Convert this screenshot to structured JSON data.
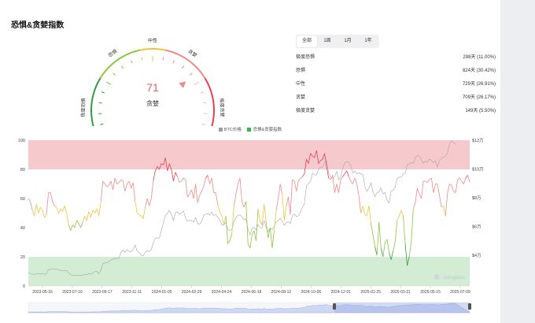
{
  "title": "恐惧&贪婪指数",
  "gauge": {
    "value": 71,
    "label": "贪婪",
    "zones": [
      "极度恐惧",
      "恐惧",
      "中性",
      "贪婪",
      "极度贪婪"
    ],
    "colors": [
      "#2e9e3e",
      "#8dc63f",
      "#f2c43d",
      "#f08a8a",
      "#e8404f"
    ]
  },
  "tabs": [
    {
      "label": "全部",
      "active": true
    },
    {
      "label": "1周",
      "active": false
    },
    {
      "label": "1月",
      "active": false
    },
    {
      "label": "1年",
      "active": false
    }
  ],
  "stats": [
    {
      "label": "极度恐惧",
      "value": "298天 (11.00%)"
    },
    {
      "label": "恐惧",
      "value": "824天 (30.42%)"
    },
    {
      "label": "中性",
      "value": "729天 (26.91%)"
    },
    {
      "label": "贪婪",
      "value": "709天 (26.17%)"
    },
    {
      "label": "极度贪婪",
      "value": "149天 (5.50%)"
    }
  ],
  "watermark": "coinglass",
  "chart_data": {
    "type": "line",
    "legend": [
      {
        "name": "BTC价格",
        "color": "#9e9e9e"
      },
      {
        "name": "恐惧&贪婪指数",
        "color": "#3cb44b"
      }
    ],
    "legend_position": "top-center",
    "x_ticks": [
      "2023-05-16",
      "2023-07-10",
      "2023-09-17",
      "2023-11-11",
      "2024-01-05",
      "2024-02-29",
      "2024-04-24",
      "2024-06-18",
      "2024-08-12",
      "2024-10-06",
      "2024-12-01",
      "2025-01-25",
      "2025-03-21",
      "2025-05-15",
      "2025-07-09"
    ],
    "y_left_ticks": [
      0,
      20,
      40,
      60,
      80,
      100
    ],
    "y_left_range": [
      0,
      100
    ],
    "y_right_ticks": [
      "$4万",
      "$6万",
      "$8万",
      "$10万",
      "$12万"
    ],
    "y_right_values": [
      40000,
      60000,
      80000,
      100000,
      120000
    ],
    "y_right_range": [
      18500,
      120000
    ],
    "bands": [
      {
        "from": 80,
        "to": 100,
        "color": "#f6c9cc"
      },
      {
        "from": 0,
        "to": 20,
        "color": "#d3ecd4"
      }
    ],
    "zone_colors": {
      "extreme_fear": "#2e9e3e",
      "fear": "#8dc63f",
      "neutral": "#f2c43d",
      "greed": "#f08a8a",
      "extreme_greed": "#e8404f"
    },
    "series": [
      {
        "name": "BTC价格",
        "values": [
          27500,
          27200,
          26800,
          26500,
          27000,
          27100,
          26900,
          27200,
          26500,
          27000,
          29800,
          30200,
          30500,
          30400,
          30200,
          29900,
          29300,
          29100,
          29300,
          29200,
          27800,
          26300,
          26100,
          25900,
          26000,
          26000,
          25800,
          26100,
          26600,
          26300,
          27200,
          26700,
          27600,
          28500,
          28700,
          27100,
          29400,
          34000,
          34500,
          34700,
          35400,
          36700,
          37100,
          37800,
          37600,
          37900,
          41800,
          43400,
          42000,
          43700,
          42500,
          42300,
          44200,
          46900,
          42800,
          41700,
          40000,
          39500,
          41800,
          43000,
          42500,
          43700,
          48300,
          51800,
          52000,
          51800,
          57000,
          62500,
          67500,
          69000,
          71200,
          68300,
          64000,
          69600,
          70200,
          68400,
          69500,
          70800,
          66100,
          63500,
          64400,
          64000,
          63000,
          66200,
          62000,
          61500,
          63400,
          67900,
          68400,
          69100,
          67800,
          70100,
          67500,
          68500,
          66300,
          64700,
          61000,
          60900,
          62700,
          57900,
          57000,
          57800,
          63300,
          66200,
          67500,
          68100,
          66600,
          64500,
          65300,
          58100,
          54000,
          58700,
          59400,
          57600,
          61200,
          58900,
          59100,
          64000,
          59200,
          56300,
          59000,
          57500,
          60200,
          63200,
          64000,
          65600,
          63300,
          60800,
          62500,
          63200,
          62000,
          67400,
          68500,
          67000,
          67400,
          69900,
          73300,
          75800,
          88400,
          89800,
          91000,
          97000,
          95800,
          95900,
          99800,
          101200,
          101300,
          104400,
          106000,
          97100,
          94300,
          93500,
          94500,
          98200,
          92500,
          94500,
          100500,
          104400,
          105000,
          104700,
          102200,
          97200,
          98600,
          96500,
          97300,
          96500,
          96200,
          88000,
          84400,
          86700,
          90300,
          84200,
          80600,
          83500,
          84000,
          87000,
          82600,
          83500,
          78400,
          76300,
          84500,
          85300,
          87500,
          93400,
          94300,
          94200,
          96500,
          97100,
          102900,
          103500,
          104600,
          103800,
          107900,
          109500,
          108800,
          106300,
          104000,
          105500,
          104600,
          106800,
          106000,
          104500,
          105600,
          101500,
          106200,
          107200,
          108500,
          108900,
          111300,
          117500,
          119800,
          118200,
          117400
        ]
      },
      {
        "name": "恐惧&贪婪指数",
        "values": [
          60,
          58,
          52,
          48,
          56,
          50,
          54,
          52,
          47,
          49,
          64,
          64,
          58,
          55,
          54,
          50,
          53,
          51,
          55,
          50,
          42,
          38,
          42,
          40,
          45,
          43,
          40,
          44,
          48,
          45,
          51,
          47,
          52,
          50,
          53,
          48,
          58,
          72,
          70,
          68,
          69,
          72,
          66,
          74,
          70,
          71,
          73,
          72,
          65,
          70,
          72,
          67,
          71,
          58,
          50,
          49,
          48,
          46,
          54,
          60,
          55,
          60,
          72,
          79,
          82,
          80,
          84,
          83,
          88,
          79,
          84,
          80,
          72,
          78,
          75,
          71,
          72,
          74,
          73,
          61,
          63,
          66,
          60,
          70,
          57,
          62,
          65,
          68,
          74,
          76,
          70,
          74,
          64,
          64,
          56,
          51,
          48,
          42,
          48,
          29,
          31,
          36,
          55,
          63,
          70,
          74,
          58,
          54,
          58,
          29,
          26,
          35,
          38,
          31,
          53,
          44,
          42,
          56,
          44,
          33,
          40,
          26,
          38,
          52,
          60,
          70,
          63,
          45,
          55,
          61,
          49,
          73,
          72,
          65,
          72,
          74,
          75,
          77,
          87,
          84,
          91,
          89,
          88,
          93,
          84,
          86,
          87,
          91,
          82,
          74,
          73,
          76,
          64,
          70,
          64,
          73,
          75,
          77,
          79,
          75,
          72,
          70,
          74,
          70,
          62,
          50,
          55,
          49,
          48,
          55,
          43,
          35,
          27,
          21,
          44,
          26,
          20,
          30,
          32,
          23,
          18,
          24,
          30,
          45,
          48,
          52,
          48,
          29,
          14,
          20,
          30,
          53,
          57,
          67,
          63,
          60,
          72,
          72,
          71,
          73,
          74,
          64,
          70,
          70,
          62,
          54,
          55,
          48,
          64,
          70,
          69,
          65,
          64,
          73,
          74,
          72,
          70,
          74,
          76,
          71
        ]
      }
    ]
  }
}
